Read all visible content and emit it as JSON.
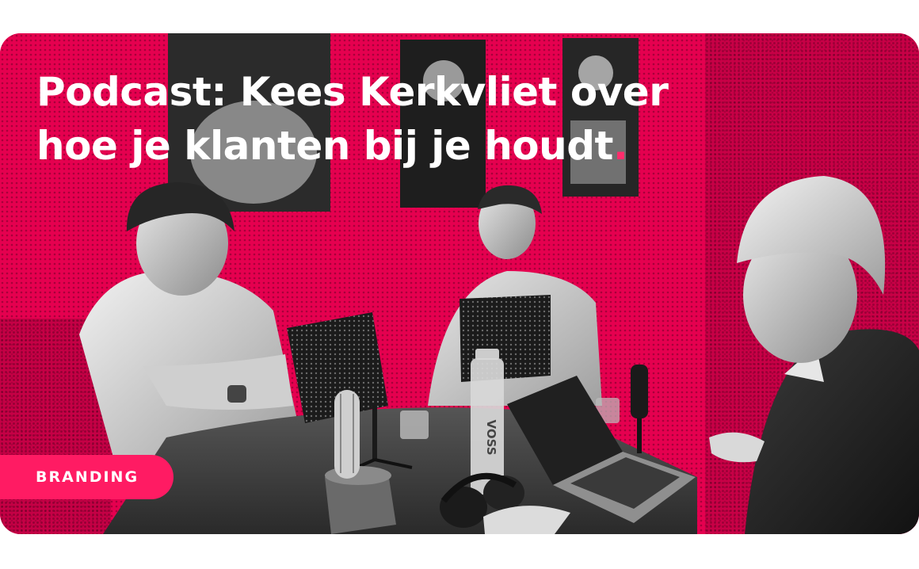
{
  "article": {
    "title_line1": "Podcast: Kees Kerkvliet over",
    "title_line2": "hoe je klanten bij je houdt",
    "title_end_mark": ".",
    "category": "BRANDING"
  },
  "photo": {
    "text_on_bottle": "VOSS"
  },
  "colors": {
    "brand_pink": "#e3004f",
    "tag_pink": "#ff1b63",
    "text": "#ffffff"
  }
}
